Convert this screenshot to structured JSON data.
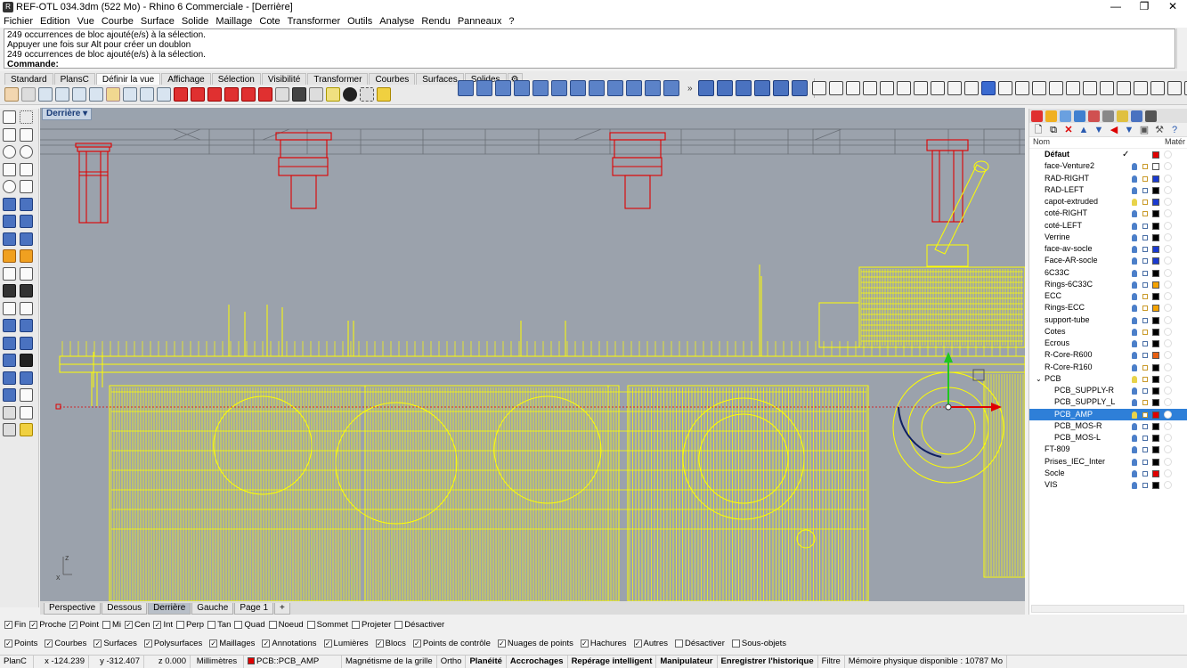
{
  "window": {
    "title": "REF-OTL 034.3dm (522 Mo) - Rhino 6 Commerciale - [Derrière]",
    "buttons": [
      "—",
      "❐",
      "✕"
    ]
  },
  "menu": [
    "Fichier",
    "Edition",
    "Vue",
    "Courbe",
    "Surface",
    "Solide",
    "Maillage",
    "Cote",
    "Transformer",
    "Outils",
    "Analyse",
    "Rendu",
    "Panneaux",
    "?"
  ],
  "command_history": {
    "lines": [
      "249 occurrences de bloc ajouté(e/s) à la sélection.",
      "Appuyer une fois sur Alt pour créer un doublon",
      "249 occurrences de bloc ajouté(e/s) à la sélection."
    ],
    "prompt": "Commande:"
  },
  "toolbar_tabs": [
    "Standard",
    "PlansC",
    "Définir la vue",
    "Affichage",
    "Sélection",
    "Visibilité",
    "Transformer",
    "Courbes",
    "Surfaces",
    "Solides"
  ],
  "toolbar_tab_active": "Définir la vue",
  "viewport": {
    "name": "Derrière",
    "axis_labels": {
      "y": "z",
      "x": "x"
    },
    "colors": {
      "background": "#9ba2ac",
      "selected": "#ffff00",
      "red_blocks": "#e00000"
    }
  },
  "viewport_tabs": [
    "Perspective",
    "Dessous",
    "Derrière",
    "Gauche",
    "Page 1",
    "+"
  ],
  "viewport_tab_active": "Derrière",
  "layers": {
    "header_name": "Nom",
    "header_material": "Matér",
    "items": [
      {
        "name": "Défaut",
        "check": true,
        "color": "#e00000",
        "bold": true,
        "level": 0,
        "bulb": false
      },
      {
        "name": "face-Venture2",
        "color": "#ffffff",
        "level": 0,
        "bulb": true,
        "lock_open": true
      },
      {
        "name": "RAD-RIGHT",
        "color": "#1a3ad0",
        "level": 0,
        "bulb": true,
        "lock_open": true
      },
      {
        "name": "RAD-LEFT",
        "color": "#000000",
        "level": 0,
        "bulb": true
      },
      {
        "name": "capot-extruded",
        "color": "#1a3ad0",
        "level": 0,
        "bulb": true,
        "bulb_off": true,
        "lock_open": true
      },
      {
        "name": "coté-RIGHT",
        "color": "#000000",
        "level": 0,
        "bulb": true,
        "lock_open": true
      },
      {
        "name": "coté-LEFT",
        "color": "#000000",
        "level": 0,
        "bulb": true
      },
      {
        "name": "Verrine",
        "color": "#000000",
        "level": 0,
        "bulb": true
      },
      {
        "name": "face-av-socle",
        "color": "#1a3ad0",
        "level": 0,
        "bulb": true
      },
      {
        "name": "Face-AR-socle",
        "color": "#1a3ad0",
        "level": 0,
        "bulb": true
      },
      {
        "name": "6C33C",
        "color": "#000000",
        "level": 0,
        "bulb": true
      },
      {
        "name": "Rings-6C33C",
        "color": "#f5a300",
        "level": 0,
        "bulb": true
      },
      {
        "name": "ECC",
        "color": "#000000",
        "level": 0,
        "bulb": true,
        "lock_open": true
      },
      {
        "name": "Rings-ECC",
        "color": "#f5a300",
        "level": 0,
        "bulb": true,
        "lock_open": true
      },
      {
        "name": "support-tube",
        "color": "#000000",
        "level": 0,
        "bulb": true
      },
      {
        "name": "Cotes",
        "color": "#000000",
        "level": 0,
        "bulb": true,
        "lock_open": true
      },
      {
        "name": "Ecrous",
        "color": "#000000",
        "level": 0,
        "bulb": true
      },
      {
        "name": "R-Core-R600",
        "color": "#e86010",
        "level": 0,
        "bulb": true
      },
      {
        "name": "R-Core-R160",
        "color": "#000000",
        "level": 0,
        "bulb": true,
        "lock_open": true
      },
      {
        "name": "PCB",
        "color": "#000000",
        "level": 0,
        "bulb": true,
        "bulb_off": true,
        "lock_open": true,
        "expanded": true
      },
      {
        "name": "PCB_SUPPLY-R",
        "color": "#000000",
        "level": 1,
        "bulb": true
      },
      {
        "name": "PCB_SUPPLY_L",
        "color": "#000000",
        "level": 1,
        "bulb": true,
        "lock_open": true
      },
      {
        "name": "PCB_AMP",
        "color": "#e00000",
        "level": 1,
        "bulb": true,
        "bulb_off": true,
        "lock_open": true,
        "selected": true
      },
      {
        "name": "PCB_MOS-R",
        "color": "#000000",
        "level": 1,
        "bulb": true
      },
      {
        "name": "PCB_MOS-L",
        "color": "#000000",
        "level": 1,
        "bulb": true
      },
      {
        "name": "FT-809",
        "color": "#000000",
        "level": 0,
        "bulb": true
      },
      {
        "name": "Prises_IEC_Inter",
        "color": "#000000",
        "level": 0,
        "bulb": true
      },
      {
        "name": "Socle",
        "color": "#e00000",
        "level": 0,
        "bulb": true
      },
      {
        "name": "VIS",
        "color": "#000000",
        "level": 0,
        "bulb": true
      }
    ]
  },
  "osnaps": [
    {
      "label": "Fin",
      "checked": true
    },
    {
      "label": "Proche",
      "checked": true
    },
    {
      "label": "Point",
      "checked": true
    },
    {
      "label": "Mi",
      "checked": false
    },
    {
      "label": "Cen",
      "checked": true
    },
    {
      "label": "Int",
      "checked": true
    },
    {
      "label": "Perp",
      "checked": false
    },
    {
      "label": "Tan",
      "checked": false
    },
    {
      "label": "Quad",
      "checked": false
    },
    {
      "label": "Noeud",
      "checked": false
    },
    {
      "label": "Sommet",
      "checked": false
    },
    {
      "label": "Projeter",
      "checked": false
    },
    {
      "label": "Désactiver",
      "checked": false
    }
  ],
  "filters": [
    {
      "label": "Points",
      "checked": true
    },
    {
      "label": "Courbes",
      "checked": true
    },
    {
      "label": "Surfaces",
      "checked": true
    },
    {
      "label": "Polysurfaces",
      "checked": true
    },
    {
      "label": "Maillages",
      "checked": true
    },
    {
      "label": "Annotations",
      "checked": true
    },
    {
      "label": "Lumières",
      "checked": true
    },
    {
      "label": "Blocs",
      "checked": true
    },
    {
      "label": "Points de contrôle",
      "checked": true
    },
    {
      "label": "Nuages de points",
      "checked": true
    },
    {
      "label": "Hachures",
      "checked": true
    },
    {
      "label": "Autres",
      "checked": true
    },
    {
      "label": "Désactiver",
      "checked": false
    },
    {
      "label": "Sous-objets",
      "checked": false
    }
  ],
  "status": {
    "cplane": "PlanC",
    "x": "x -124.239",
    "y": "y -312.407",
    "z": "z 0.000",
    "units": "Millimètres",
    "layer": "PCB::PCB_AMP",
    "grid_snap": "Magnétisme de la grille",
    "ortho": "Ortho",
    "planar": "Planéité",
    "osnap": "Accrochages",
    "smarttrack": "Repérage intelligent",
    "gumball": "Manipulateur",
    "history": "Enregistrer l'historique",
    "filter": "Filtre",
    "memory": "Mémoire physique disponible : 10787 Mo"
  }
}
